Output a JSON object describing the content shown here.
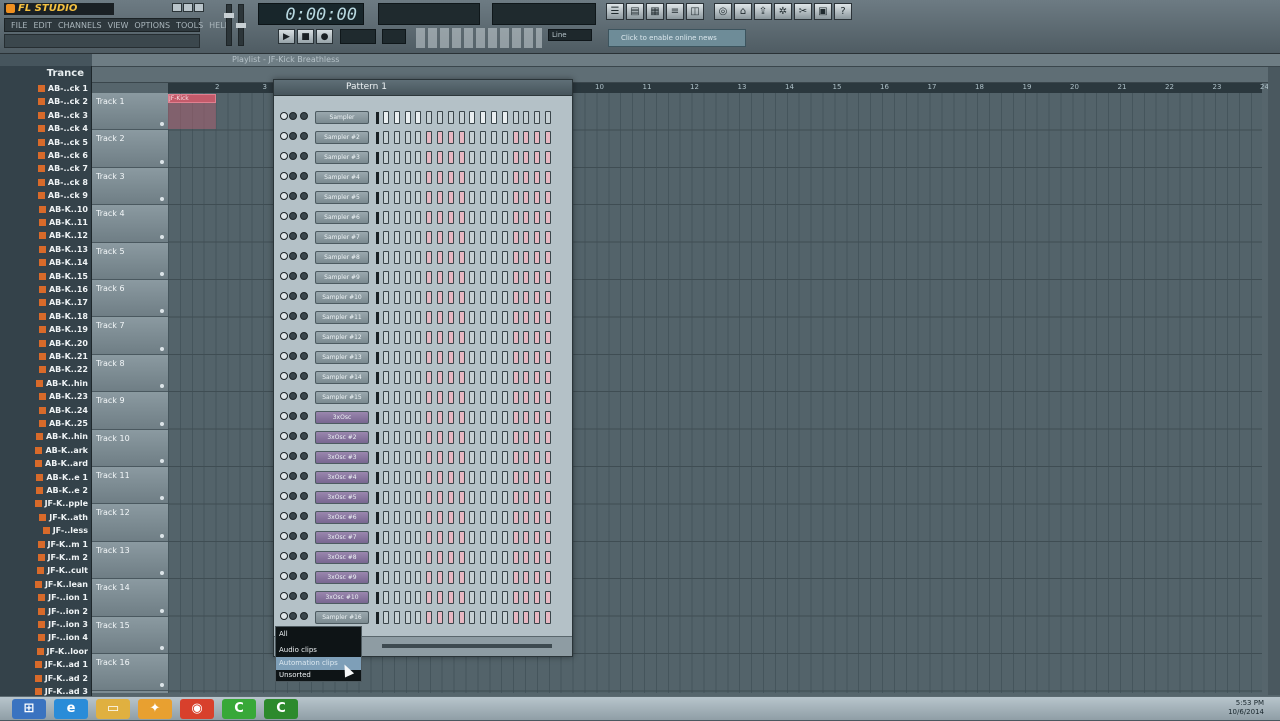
{
  "app": {
    "name": "FL STUDIO"
  },
  "menu": [
    "FILE",
    "EDIT",
    "CHANNELS",
    "VIEW",
    "OPTIONS",
    "TOOLS",
    "HELP"
  ],
  "transport": {
    "time": "0:00:00",
    "mode": "Line",
    "hint": "Click to enable online news"
  },
  "browser": {
    "title": "Trance",
    "items": [
      "AB-..ck 1",
      "AB-..ck 2",
      "AB-..ck 3",
      "AB-..ck 4",
      "AB-..ck 5",
      "AB-..ck 6",
      "AB-..ck 7",
      "AB-..ck 8",
      "AB-..ck 9",
      "AB-K..10",
      "AB-K..11",
      "AB-K..12",
      "AB-K..13",
      "AB-K..14",
      "AB-K..15",
      "AB-K..16",
      "AB-K..17",
      "AB-K..18",
      "AB-K..19",
      "AB-K..20",
      "AB-K..21",
      "AB-K..22",
      "AB-K..hin",
      "AB-K..23",
      "AB-K..24",
      "AB-K..25",
      "AB-K..hin",
      "AB-K..ark",
      "AB-K..ard",
      "AB-K..e 1",
      "AB-K..e 2",
      "JF-K..pple",
      "JF-K..ath",
      "JF-..less",
      "JF-K..m 1",
      "JF-K..m 2",
      "JF-K..cult",
      "JF-K..lean",
      "JF-..ion 1",
      "JF-..ion 2",
      "JF-..ion 3",
      "JF-..ion 4",
      "JF-K..loor",
      "JF-K..ad 1",
      "JF-K..ad 2",
      "JF-K..ad 3"
    ]
  },
  "playlist": {
    "title": "Playlist - JF-Kick Breathless",
    "ruler": [
      "2",
      "3",
      "4",
      "5",
      "6",
      "7",
      "8",
      "9",
      "10",
      "11",
      "12",
      "13",
      "14",
      "15",
      "16",
      "17",
      "18",
      "19",
      "20",
      "21",
      "22",
      "23",
      "24"
    ],
    "tracks": [
      "Track 1",
      "Track 2",
      "Track 3",
      "Track 4",
      "Track 5",
      "Track 6",
      "Track 7",
      "Track 8",
      "Track 9",
      "Track 10",
      "Track 11",
      "Track 12",
      "Track 13",
      "Track 14",
      "Track 15",
      "Track 16"
    ],
    "clip_label": "JF-Kick Breathless"
  },
  "rack": {
    "pattern": "Pattern 1",
    "channels": [
      "Sampler",
      "Sampler #2",
      "Sampler #3",
      "Sampler #4",
      "Sampler #5",
      "Sampler #6",
      "Sampler #7",
      "Sampler #8",
      "Sampler #9",
      "Sampler #10",
      "Sampler #11",
      "Sampler #12",
      "Sampler #13",
      "Sampler #14",
      "Sampler #15",
      "3xOsc",
      "3xOsc #2",
      "3xOsc #3",
      "3xOsc #4",
      "3xOsc #5",
      "3xOsc #6",
      "3xOsc #7",
      "3xOsc #8",
      "3xOsc #9",
      "3xOsc #10",
      "Sampler #16"
    ]
  },
  "filter_menu": {
    "items": [
      "All",
      "Audio clips",
      "Automation clips",
      "Unsorted"
    ],
    "selected_index": 2
  },
  "taskbar": {
    "time": "5:53 PM",
    "date": "10/6/2014"
  },
  "colors": {
    "accent": "#f09020",
    "clip": "#c45a6a",
    "step_pink": "#e8b7c2",
    "step_white": "#e9eef0",
    "selection": "#7e9fb8"
  }
}
